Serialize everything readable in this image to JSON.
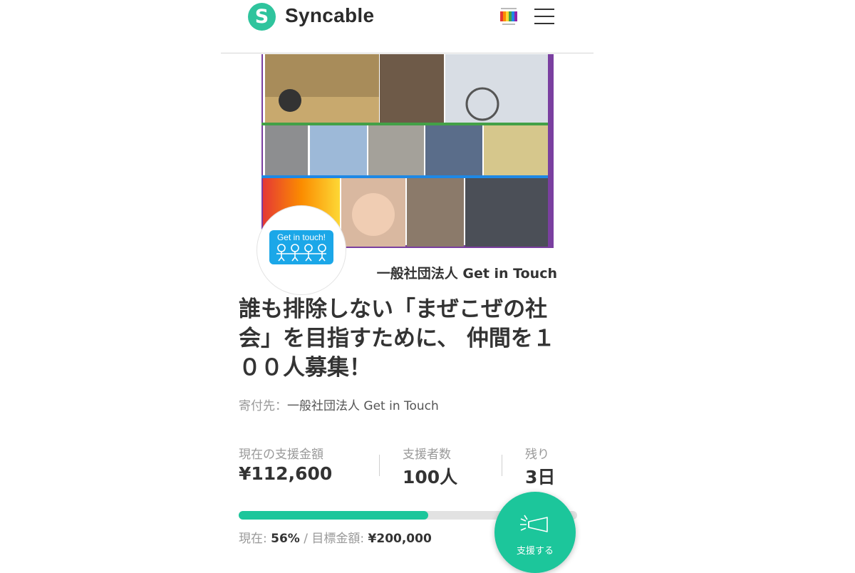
{
  "header": {
    "logo_letter": "S",
    "logo_text": "Syncable"
  },
  "colors": {
    "brand": "#1cc69b",
    "logo": "#2fc49d",
    "avatar_bg": "#1ba7e8"
  },
  "hero": {
    "avatar_text": "Get in touch!",
    "org_name": "一般社団法人 Get in Touch"
  },
  "project": {
    "title": "誰も排除しない「まぜこぜの社会」を目指すために、 仲間を１００人募集！",
    "donee_label": "寄付先：",
    "donee_name": "一般社団法人 Get in Touch"
  },
  "stats": [
    {
      "label": "現在の支援金額",
      "value": "¥112,600"
    },
    {
      "label": "支援者数",
      "value": "100人"
    },
    {
      "label": "残り",
      "value": "3日"
    }
  ],
  "progress": {
    "percent": 56,
    "current_label": "現在:",
    "percent_text": "56%",
    "separator": "/",
    "goal_label": "目標金額:",
    "goal_value": "¥200,000"
  },
  "cta": {
    "label": "支援する",
    "icon": "megaphone-icon"
  }
}
